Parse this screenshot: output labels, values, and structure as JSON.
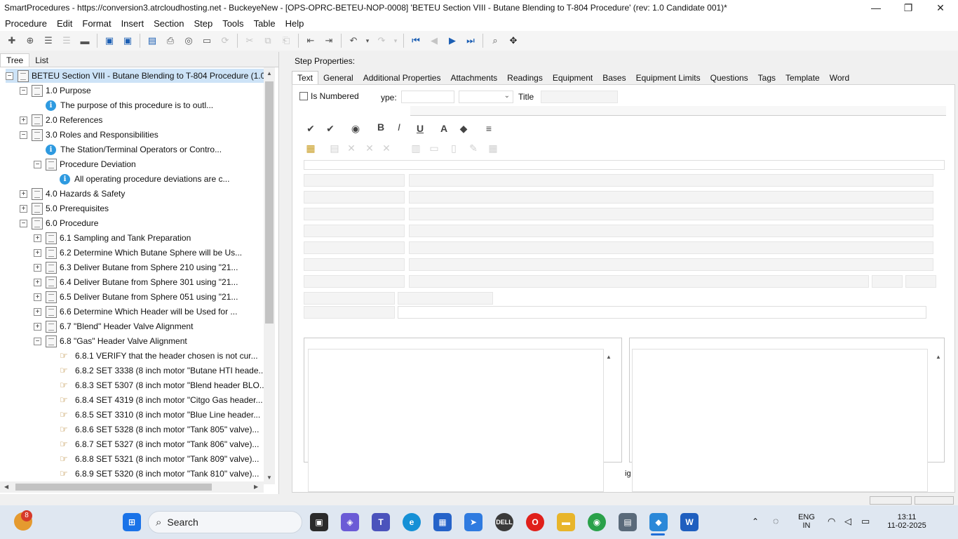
{
  "window": {
    "title": "SmartProcedures - https://conversion3.atrcloudhosting.net - BuckeyeNew - [OPS-OPRC-BETEU-NOP-0008] 'BETEU Section VIII - Butane Blending to T-804 Procedure' (rev: 1.0 Candidate 001)*",
    "minimize": "—",
    "restore": "❐",
    "close": "✕"
  },
  "menu": [
    "Procedure",
    "Edit",
    "Format",
    "Insert",
    "Section",
    "Step",
    "Tools",
    "Table",
    "Help"
  ],
  "left_tabs": [
    "Tree",
    "List"
  ],
  "tree": [
    {
      "level": 0,
      "icon": "doc",
      "expander": "−",
      "label": "BETEU Section VIII - Butane Blending to T-804 Procedure (1.0...",
      "selected": true
    },
    {
      "level": 1,
      "icon": "doc",
      "expander": "−",
      "label": "1.0 Purpose"
    },
    {
      "level": 2,
      "icon": "info",
      "expander": "",
      "label": "The purpose of this procedure is to outl..."
    },
    {
      "level": 1,
      "icon": "doc",
      "expander": "+",
      "label": "2.0 References"
    },
    {
      "level": 1,
      "icon": "doc",
      "expander": "−",
      "label": "3.0 Roles and Responsibilities"
    },
    {
      "level": 2,
      "icon": "info",
      "expander": "",
      "label": "The Station/Terminal Operators or Contro..."
    },
    {
      "level": 2,
      "icon": "doc",
      "expander": "−",
      "label": "Procedure Deviation"
    },
    {
      "level": 3,
      "icon": "info",
      "expander": "",
      "label": "All operating procedure deviations are c..."
    },
    {
      "level": 1,
      "icon": "doc",
      "expander": "+",
      "label": "4.0 Hazards & Safety"
    },
    {
      "level": 1,
      "icon": "doc",
      "expander": "+",
      "label": "5.0 Prerequisites"
    },
    {
      "level": 1,
      "icon": "doc",
      "expander": "−",
      "label": "6.0 Procedure"
    },
    {
      "level": 2,
      "icon": "doc",
      "expander": "+",
      "label": "6.1 Sampling and Tank Preparation"
    },
    {
      "level": 2,
      "icon": "doc",
      "expander": "+",
      "label": "6.2 Determine Which Butane Sphere will be Us..."
    },
    {
      "level": 2,
      "icon": "doc",
      "expander": "+",
      "label": "6.3 Deliver Butane from Sphere 210 using \"21..."
    },
    {
      "level": 2,
      "icon": "doc",
      "expander": "+",
      "label": "6.4 Deliver Butane from Sphere 301 using \"21..."
    },
    {
      "level": 2,
      "icon": "doc",
      "expander": "+",
      "label": "6.5 Deliver Butane from Sphere 051 using \"21..."
    },
    {
      "level": 2,
      "icon": "doc",
      "expander": "+",
      "label": "6.6 Determine Which Header will be Used for ..."
    },
    {
      "level": 2,
      "icon": "doc",
      "expander": "+",
      "label": "6.7 \"Blend\" Header Valve Alignment"
    },
    {
      "level": 2,
      "icon": "doc",
      "expander": "−",
      "label": "6.8 \"Gas\" Header Valve Alignment"
    },
    {
      "level": 3,
      "icon": "hand",
      "expander": "",
      "label": "6.8.1 VERIFY that the header chosen is not cur..."
    },
    {
      "level": 3,
      "icon": "hand",
      "expander": "",
      "label": "6.8.2 SET 3338 (8 inch motor \"Butane HTI heade..."
    },
    {
      "level": 3,
      "icon": "hand",
      "expander": "",
      "label": "6.8.3 SET 5307 (8 inch motor \"Blend header BLO..."
    },
    {
      "level": 3,
      "icon": "hand",
      "expander": "",
      "label": "6.8.4 SET 4319 (8 inch motor \"Citgo Gas header..."
    },
    {
      "level": 3,
      "icon": "hand",
      "expander": "",
      "label": "6.8.5 SET 3310 (8 inch motor \"Blue Line header..."
    },
    {
      "level": 3,
      "icon": "hand",
      "expander": "",
      "label": "6.8.6 SET 5328 (8 inch motor \"Tank 805\" valve)..."
    },
    {
      "level": 3,
      "icon": "hand",
      "expander": "",
      "label": "6.8.7 SET 5327 (8 inch motor \"Tank 806\" valve)..."
    },
    {
      "level": 3,
      "icon": "hand",
      "expander": "",
      "label": "6.8.8 SET 5321 (8 inch motor \"Tank 809\" valve)..."
    },
    {
      "level": 3,
      "icon": "hand",
      "expander": "",
      "label": "6.8.9 SET 5320 (8 inch motor \"Tank 810\" valve)..."
    }
  ],
  "step_properties": {
    "heading": "Step Properties:",
    "tabs": [
      "Text",
      "General",
      "Additional Properties",
      "Attachments",
      "Readings",
      "Equipment",
      "Bases",
      "Equipment Limits",
      "Questions",
      "Tags",
      "Template",
      "Word"
    ],
    "is_numbered_label": "Is Numbered",
    "type_label": "ype:",
    "title_label": "Title",
    "partial_label": "ig"
  },
  "taskbar": {
    "badge": "8",
    "search_label": "Search",
    "lang_top": "ENG",
    "lang_bottom": "IN",
    "time": "13:11",
    "date": "11-02-2025"
  }
}
